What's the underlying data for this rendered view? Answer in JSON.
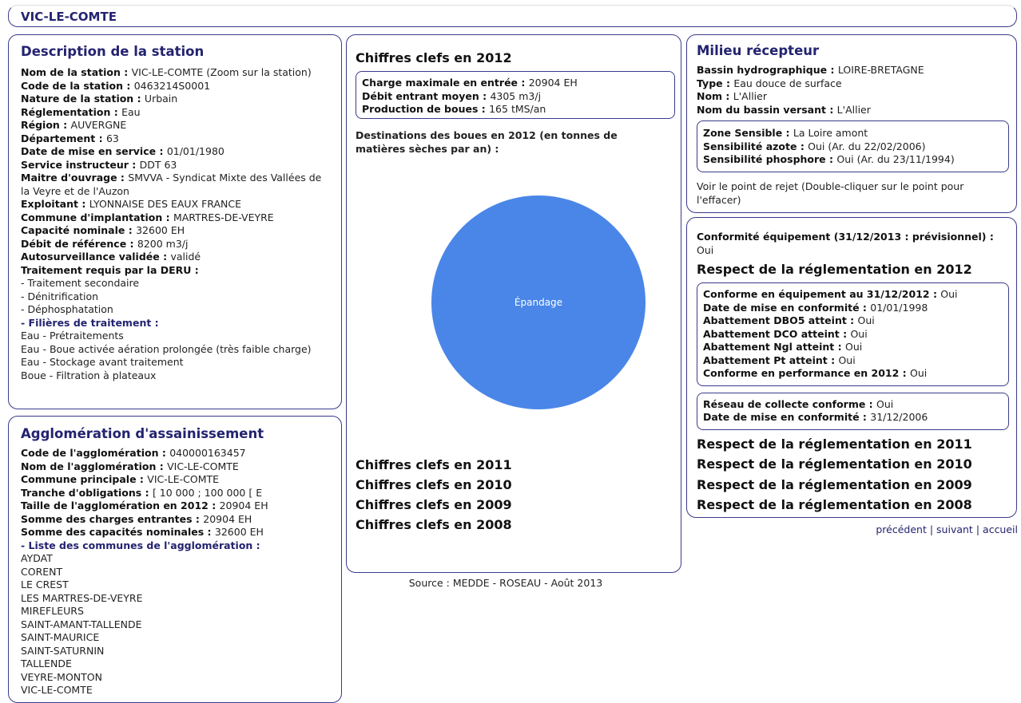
{
  "header": {
    "title": "VIC-LE-COMTE"
  },
  "station": {
    "title": "Description de la station",
    "fields": [
      {
        "label": "Nom de la station : ",
        "value": "VIC-LE-COMTE (Zoom sur la station)"
      },
      {
        "label": "Code de la station : ",
        "value": "0463214S0001"
      },
      {
        "label": "Nature de la station : ",
        "value": "Urbain"
      },
      {
        "label": "Réglementation : ",
        "value": "Eau"
      },
      {
        "label": "Région : ",
        "value": "AUVERGNE"
      },
      {
        "label": "Département : ",
        "value": "63"
      },
      {
        "label": "Date de mise en service : ",
        "value": "01/01/1980"
      },
      {
        "label": "Service instructeur : ",
        "value": "DDT 63"
      },
      {
        "label": "Maitre d'ouvrage : ",
        "value": "SMVVA - Syndicat Mixte des Vallées de la Veyre et de l'Auzon"
      },
      {
        "label": "Exploitant : ",
        "value": "LYONNAISE DES EAUX FRANCE"
      },
      {
        "label": "Commune d'implantation : ",
        "value": "MARTRES-DE-VEYRE"
      },
      {
        "label": "Capacité nominale : ",
        "value": "32600 EH"
      },
      {
        "label": "Débit de référence : ",
        "value": "8200 m3/j"
      },
      {
        "label": "Autosurveillance validée : ",
        "value": "validé"
      }
    ],
    "deru_label": "Traitement requis par la DERU :",
    "deru": [
      "- Traitement secondaire",
      "- Dénitrification",
      "- Déphosphatation"
    ],
    "filieres_label": "- Filières de traitement :",
    "filieres": [
      "Eau - Prétraitements",
      "Eau - Boue activée aération prolongée (très faible charge)",
      "Eau - Stockage avant traitement",
      "Boue - Filtration à plateaux"
    ]
  },
  "agglo": {
    "title": "Agglomération d'assainissement",
    "fields": [
      {
        "label": "Code de l'agglomération : ",
        "value": "040000163457"
      },
      {
        "label": "Nom de l'agglomération : ",
        "value": "VIC-LE-COMTE"
      },
      {
        "label": "Commune principale : ",
        "value": "VIC-LE-COMTE"
      },
      {
        "label": "Tranche d'obligations : ",
        "value": "[ 10 000 ; 100 000 [ E"
      },
      {
        "label": "Taille de l'agglomération en 2012 : ",
        "value": "20904 EH"
      },
      {
        "label": "Somme des charges entrantes : ",
        "value": "20904 EH"
      },
      {
        "label": "Somme des capacités nominales : ",
        "value": "32600 EH"
      }
    ],
    "communes_label": "- Liste des communes de l'agglomération :",
    "communes": [
      "AYDAT",
      "CORENT",
      "LE CREST",
      "LES MARTRES-DE-VEYRE",
      "MIREFLEURS",
      "SAINT-AMANT-TALLENDE",
      "SAINT-MAURICE",
      "SAINT-SATURNIN",
      "TALLENDE",
      "VEYRE-MONTON",
      "VIC-LE-COMTE"
    ]
  },
  "chiffres": {
    "title": "Chiffres clefs en 2012",
    "fields": [
      {
        "label": "Charge maximale en entrée  : ",
        "value": "20904 EH"
      },
      {
        "label": "Débit entrant moyen : ",
        "value": "4305 m3/j"
      },
      {
        "label": "Production de boues : ",
        "value": "165 tMS/an"
      }
    ],
    "dest_title": "Destinations des boues en 2012 (en tonnes de matières sèches par an) :",
    "other_years": [
      "Chiffres clefs en 2011",
      "Chiffres clefs en 2010",
      "Chiffres clefs en 2009",
      "Chiffres clefs en 2008"
    ]
  },
  "chart_data": {
    "type": "pie",
    "labels": [
      "Épandage"
    ],
    "values": [
      165
    ],
    "colors": [
      "#4a86e8"
    ]
  },
  "source": "Source : MEDDE - ROSEAU - Août 2013",
  "milieu": {
    "title": "Milieu récepteur",
    "fields": [
      {
        "label": "Bassin hydrographique : ",
        "value": "LOIRE-BRETAGNE"
      },
      {
        "label": "Type : ",
        "value": "Eau douce de surface"
      },
      {
        "label": "Nom : ",
        "value": "L'Allier"
      },
      {
        "label": "Nom du bassin versant : ",
        "value": "L'Allier"
      }
    ],
    "zone": [
      {
        "label": "Zone Sensible : ",
        "value": "La Loire amont"
      },
      {
        "label": "Sensibilité azote : ",
        "value": "Oui (Ar. du 22/02/2006)"
      },
      {
        "label": "Sensibilité phosphore : ",
        "value": "Oui (Ar. du 23/11/1994)"
      }
    ],
    "rejet": "Voir le point de rejet (Double-cliquer sur le point pour l'effacer)"
  },
  "conformite": {
    "equip_label": "Conformité équipement (31/12/2013 : prévisionnel) : ",
    "equip_value": "Oui",
    "respect_2012": "Respect de la réglementation en 2012",
    "box1": [
      {
        "label": "Conforme en équipement au 31/12/2012 : ",
        "value": "Oui"
      },
      {
        "label": "Date de mise en conformité : ",
        "value": "01/01/1998"
      },
      {
        "label": "Abattement DBO5 atteint : ",
        "value": "Oui"
      },
      {
        "label": "Abattement DCO atteint : ",
        "value": "Oui"
      },
      {
        "label": "Abattement Ngl atteint : ",
        "value": "Oui"
      },
      {
        "label": "Abattement Pt atteint : ",
        "value": "Oui"
      },
      {
        "label": "Conforme en performance en 2012 : ",
        "value": "Oui"
      }
    ],
    "box2": [
      {
        "label": "Réseau de collecte conforme : ",
        "value": "Oui"
      },
      {
        "label": "Date de mise en conformité : ",
        "value": "31/12/2006"
      }
    ],
    "other_years": [
      "Respect de la réglementation en 2011",
      "Respect de la réglementation en 2010",
      "Respect de la réglementation en 2009",
      "Respect de la réglementation en 2008"
    ]
  },
  "nav": {
    "prev": "précédent",
    "next": "suivant",
    "home": "accueil",
    "sep": "|"
  }
}
